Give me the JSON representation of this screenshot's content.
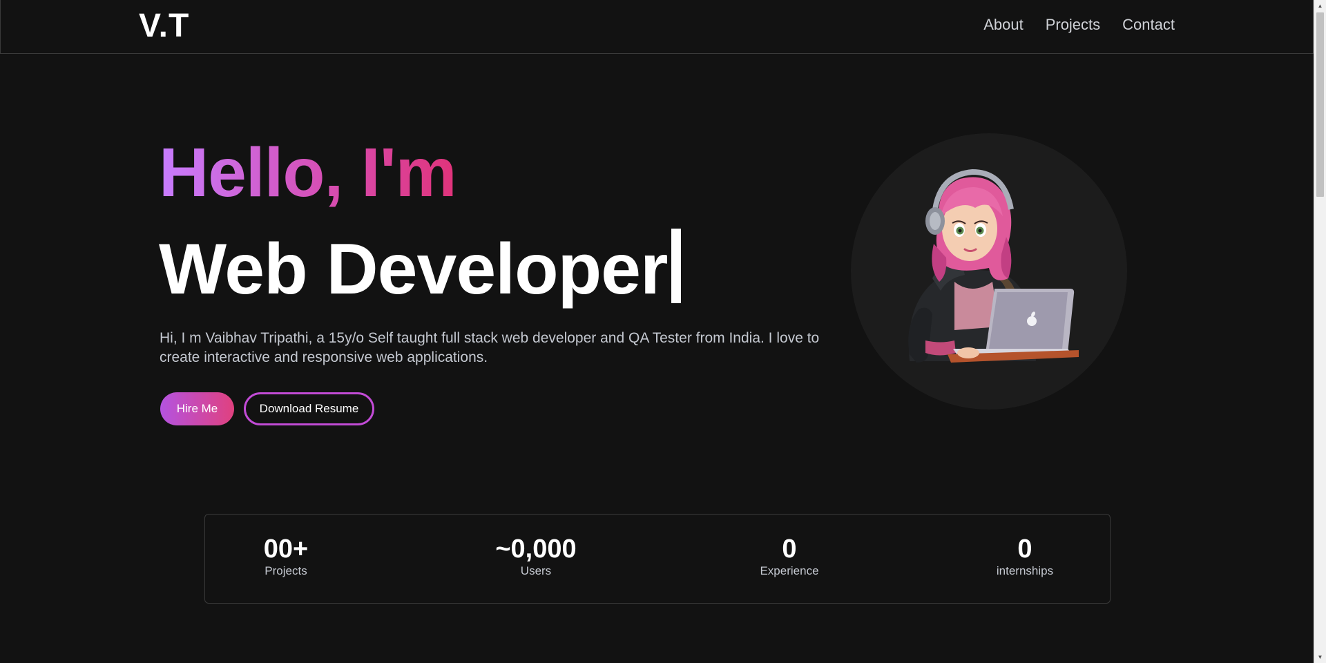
{
  "nav": {
    "logo": "V.T",
    "links": [
      "About",
      "Projects",
      "Contact"
    ]
  },
  "hero": {
    "greeting": "Hello, I'm",
    "role": "Web Developer",
    "intro": "Hi, I m Vaibhav Tripathi, a 15y/o Self taught full stack web developer and QA Tester from India. I love to create interactive and responsive web applications.",
    "hire_label": "Hire Me",
    "resume_label": "Download Resume"
  },
  "avatar": {
    "icon": "developer-girl-with-laptop-avatar"
  },
  "stats": [
    {
      "value": "00+",
      "label": "Projects"
    },
    {
      "value": "~0,000",
      "label": "Users"
    },
    {
      "value": "0",
      "label": "Experience"
    },
    {
      "value": "0",
      "label": "internships"
    }
  ],
  "colors": {
    "background": "#121212",
    "accent_purple": "#c77dff",
    "accent_pink": "#e0337a",
    "border": "#3a3a3a"
  }
}
